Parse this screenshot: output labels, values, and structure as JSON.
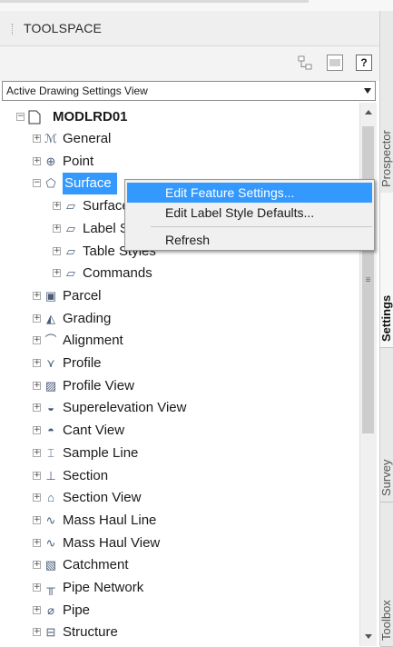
{
  "panel": {
    "title": "TOOLSPACE"
  },
  "toolbar": {
    "help_label": "?"
  },
  "view_selector": {
    "value": "Active Drawing Settings View"
  },
  "tree": {
    "root": {
      "label": "MODLRD01",
      "expander": "⊟"
    },
    "nodes": [
      {
        "label": "General",
        "icon": "general-icon",
        "glyph": "ℳ"
      },
      {
        "label": "Point",
        "icon": "point-icon",
        "glyph": "⊕"
      },
      {
        "label": "Surface",
        "icon": "surface-icon",
        "glyph": "⬠",
        "selected": true
      },
      {
        "label": "Surface Styles",
        "icon": "folder-icon",
        "glyph": "▱"
      },
      {
        "label": "Label Styles",
        "icon": "folder-icon",
        "glyph": "▱"
      },
      {
        "label": "Table Styles",
        "icon": "folder-icon",
        "glyph": "▱"
      },
      {
        "label": "Commands",
        "icon": "folder-icon",
        "glyph": "▱"
      },
      {
        "label": "Parcel",
        "icon": "parcel-icon",
        "glyph": "▣"
      },
      {
        "label": "Grading",
        "icon": "grading-icon",
        "glyph": "◭"
      },
      {
        "label": "Alignment",
        "icon": "alignment-icon",
        "glyph": "⌒"
      },
      {
        "label": "Profile",
        "icon": "profile-icon",
        "glyph": "⋎"
      },
      {
        "label": "Profile View",
        "icon": "profile-view-icon",
        "glyph": "▨"
      },
      {
        "label": "Superelevation View",
        "icon": "superelevation-icon",
        "glyph": "◒"
      },
      {
        "label": "Cant View",
        "icon": "cant-view-icon",
        "glyph": "◓"
      },
      {
        "label": "Sample Line",
        "icon": "sample-line-icon",
        "glyph": "⌶"
      },
      {
        "label": "Section",
        "icon": "section-icon",
        "glyph": "⊥"
      },
      {
        "label": "Section View",
        "icon": "section-view-icon",
        "glyph": "⌂"
      },
      {
        "label": "Mass Haul Line",
        "icon": "mass-haul-line-icon",
        "glyph": "∿"
      },
      {
        "label": "Mass Haul View",
        "icon": "mass-haul-view-icon",
        "glyph": "∿"
      },
      {
        "label": "Catchment",
        "icon": "catchment-icon",
        "glyph": "▧"
      },
      {
        "label": "Pipe Network",
        "icon": "pipe-network-icon",
        "glyph": "╥"
      },
      {
        "label": "Pipe",
        "icon": "pipe-icon",
        "glyph": "⌀"
      },
      {
        "label": "Structure",
        "icon": "structure-icon",
        "glyph": "⊟"
      }
    ]
  },
  "context_menu": {
    "items": [
      {
        "label": "Edit Feature Settings..."
      },
      {
        "label": "Edit Label Style Defaults..."
      },
      {
        "label": "Refresh"
      }
    ]
  },
  "side_tabs": [
    {
      "label": "Prospector"
    },
    {
      "label": "Settings",
      "active": true
    },
    {
      "label": "Survey"
    },
    {
      "label": "Toolbox"
    }
  ]
}
